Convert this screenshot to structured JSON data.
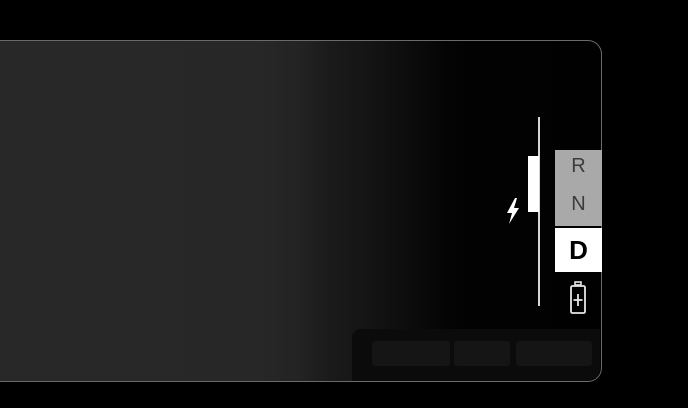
{
  "drive_panel": {
    "gears": {
      "reverse": "R",
      "neutral": "N",
      "drive": "D",
      "selected": "D"
    },
    "power_meter": {
      "regen_icon": "lightning-bolt-icon",
      "battery_icon": "battery-plus-icon"
    }
  },
  "colors": {
    "background": "#000000",
    "panel_edge": "#6a6a6a",
    "selected_gear_bg": "#ffffff",
    "unselected_gear_bg": "#a9a9a9",
    "power_indicator": "#ffffff"
  }
}
